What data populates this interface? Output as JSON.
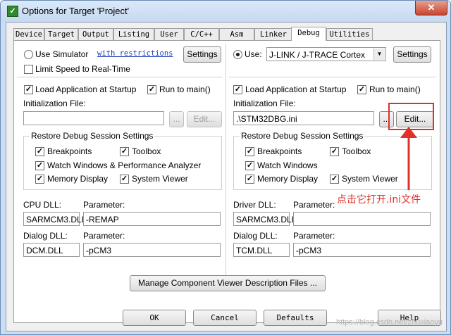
{
  "window": {
    "title": "Options for Target 'Project'",
    "close_glyph": "✕"
  },
  "tabs": [
    {
      "label": "Device"
    },
    {
      "label": "Target"
    },
    {
      "label": "Output"
    },
    {
      "label": "Listing"
    },
    {
      "label": "User"
    },
    {
      "label": "C/C++"
    },
    {
      "label": "Asm"
    },
    {
      "label": "Linker"
    },
    {
      "label": "Debug",
      "active": true
    },
    {
      "label": "Utilities"
    }
  ],
  "left": {
    "use_simulator": "Use Simulator",
    "with_restrictions": "with restrictions",
    "settings": "Settings",
    "limit_speed": "Limit Speed to Real-Time",
    "load_app": "Load Application at Startup",
    "run_to_main": "Run to main()",
    "init_file_label": "Initialization File:",
    "init_file_value": "",
    "browse": "...",
    "edit": "Edit...",
    "restore_group": "Restore Debug Session Settings",
    "breakpoints": "Breakpoints",
    "toolbox": "Toolbox",
    "watch": "Watch Windows & Performance Analyzer",
    "memory": "Memory Display",
    "system_viewer": "System Viewer",
    "cpu_dll_label": "CPU DLL:",
    "cpu_param_label": "Parameter:",
    "cpu_dll": "SARMCM3.DLL",
    "cpu_param": "-REMAP",
    "dialog_dll_label": "Dialog DLL:",
    "dialog_param_label": "Parameter:",
    "dialog_dll": "DCM.DLL",
    "dialog_param": "-pCM3"
  },
  "right": {
    "use_label": "Use:",
    "debugger": "J-LINK / J-TRACE Cortex",
    "settings": "Settings",
    "load_app": "Load Application at Startup",
    "run_to_main": "Run to main()",
    "init_file_label": "Initialization File:",
    "init_file_value": ".\\STM32DBG.ini",
    "browse": "...",
    "edit": "Edit...",
    "restore_group": "Restore Debug Session Settings",
    "breakpoints": "Breakpoints",
    "toolbox": "Toolbox",
    "watch": "Watch Windows",
    "memory": "Memory Display",
    "system_viewer": "System Viewer",
    "driver_dll_label": "Driver DLL:",
    "driver_param_label": "Parameter:",
    "driver_dll": "SARMCM3.DLL",
    "driver_param": "",
    "dialog_dll_label": "Dialog DLL:",
    "dialog_param_label": "Parameter:",
    "dialog_dll": "TCM.DLL",
    "dialog_param": "-pCM3"
  },
  "manage_button": "Manage Component Viewer Description Files ...",
  "footer": {
    "ok": "OK",
    "cancel": "Cancel",
    "defaults": "Defaults",
    "help": "Help"
  },
  "annotation": "点击它打开.ini文件",
  "watermark": "https://blog.csdn.net/zhuxiaoyu",
  "colors": {
    "annotation": "#e0302a",
    "link": "#1f3fbf"
  },
  "icons": {
    "app": "keil-target-icon",
    "check": "✓",
    "dropdown": "▼"
  }
}
